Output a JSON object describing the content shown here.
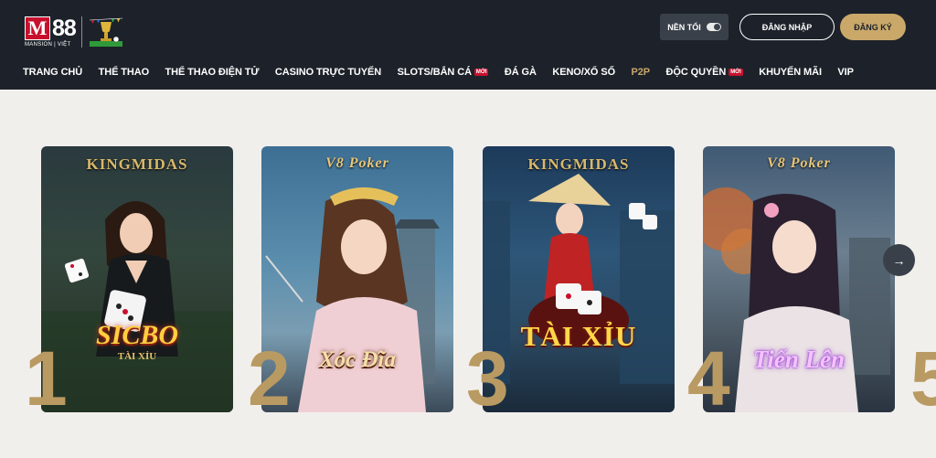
{
  "header": {
    "logo": {
      "brand_mark": "M",
      "brand_number": "88",
      "subtitle": "MANSION | VIỆT"
    },
    "theme_toggle_label": "NỀN TỐI",
    "login_label": "ĐĂNG NHẬP",
    "register_label": "ĐĂNG KÝ"
  },
  "nav": [
    {
      "label": "TRANG CHỦ"
    },
    {
      "label": "THỂ THAO"
    },
    {
      "label": "THỂ THAO ĐIỆN TỬ"
    },
    {
      "label": "CASINO TRỰC TUYẾN"
    },
    {
      "label": "SLOTS/BẮN CÁ",
      "badge": "MỚI"
    },
    {
      "label": "ĐÁ GÀ"
    },
    {
      "label": "KENO/XỔ SỐ"
    },
    {
      "label": "P2P",
      "active": true
    },
    {
      "label": "ĐỘC QUYỀN",
      "badge": "MỚI"
    },
    {
      "label": "KHUYẾN MÃI"
    },
    {
      "label": "VIP"
    }
  ],
  "games": [
    {
      "rank": "1",
      "brand": "KINGMIDAS",
      "title": "SICBO",
      "subtitle": "TÀI XỈU"
    },
    {
      "rank": "2",
      "brand": "V8 Poker",
      "title": "Xóc Đĩa"
    },
    {
      "rank": "3",
      "brand": "KINGMIDAS",
      "title": "TÀI XỈU"
    },
    {
      "rank": "4",
      "brand": "V8 Poker",
      "title": "Tiến Lên"
    },
    {
      "rank": "5"
    }
  ],
  "colors": {
    "header_bg": "#1d222a",
    "accent_gold": "#c9a86a",
    "badge_red": "#c8102e",
    "page_bg": "#f1efec"
  },
  "icons": {
    "next": "arrow-right-icon",
    "cup": "trophy-icon"
  }
}
